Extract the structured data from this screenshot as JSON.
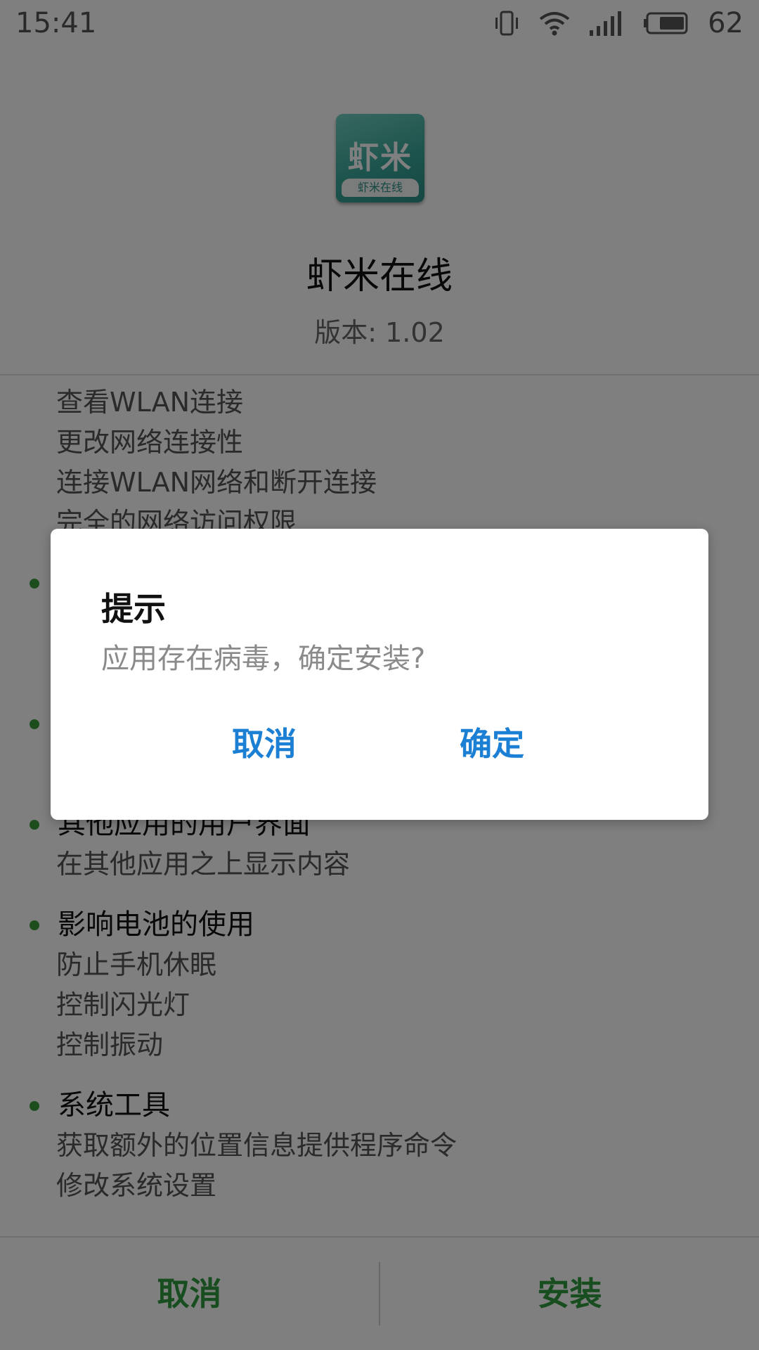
{
  "status_bar": {
    "time": "15:41",
    "battery": "62",
    "icons": [
      "vibrate-icon",
      "wifi-icon",
      "signal-icon",
      "battery-icon"
    ]
  },
  "app": {
    "icon_glyph": "虾米",
    "icon_band": "虾米在线",
    "name": "虾米在线",
    "version": "版本: 1.02"
  },
  "permissions": {
    "groups": [
      {
        "title": "",
        "items": [
          "查看WLAN连接",
          "更改网络连接性",
          "连接WLAN网络和断开连接",
          "完全的网络访问权限"
        ]
      },
      {
        "title": "",
        "items": [
          "",
          ""
        ]
      },
      {
        "title": "",
        "items": [
          ""
        ]
      },
      {
        "title": "其他应用的用户界面",
        "items": [
          "在其他应用之上显示内容"
        ]
      },
      {
        "title": "影响电池的使用",
        "items": [
          "防止手机休眠",
          "控制闪光灯",
          "控制振动"
        ]
      },
      {
        "title": "系统工具",
        "items": [
          "获取额外的位置信息提供程序命令",
          "修改系统设置"
        ]
      }
    ]
  },
  "bottom_bar": {
    "cancel_label": "取消",
    "install_label": "安装"
  },
  "dialog": {
    "title": "提示",
    "message": "应用存在病毒，确定安装?",
    "cancel_label": "取消",
    "ok_label": "确定"
  },
  "colors": {
    "accent_green": "#2e9a3f",
    "dialog_blue": "#1b7fd3",
    "bullet_green": "#3b9a3b"
  }
}
